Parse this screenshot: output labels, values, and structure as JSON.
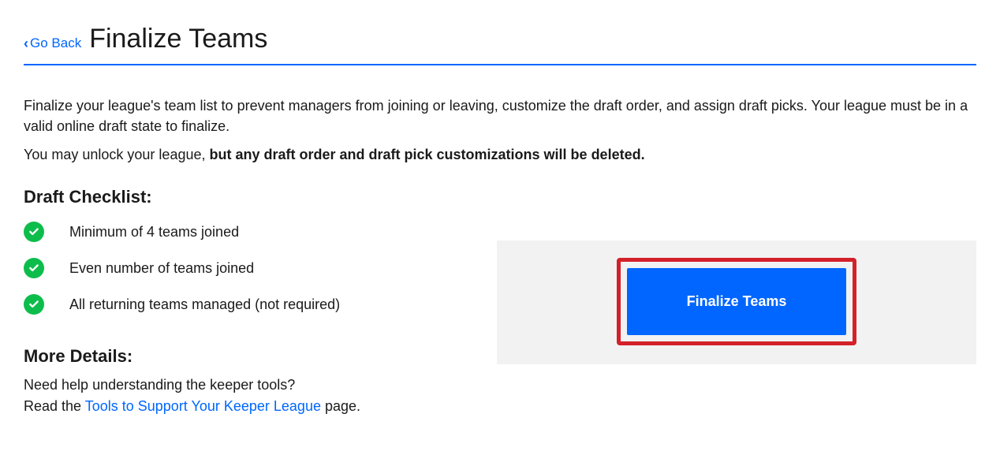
{
  "nav": {
    "go_back_label": "Go Back"
  },
  "page": {
    "title": "Finalize Teams",
    "intro": "Finalize your league's team list to prevent managers from joining or leaving, customize the draft order, and assign draft picks. Your league must be in a valid online draft state to finalize.",
    "unlock_prefix": "You may unlock your league, ",
    "unlock_bold": "but any draft order and draft pick customizations will be deleted."
  },
  "checklist": {
    "heading": "Draft Checklist:",
    "items": [
      {
        "label": "Minimum of 4 teams joined",
        "checked": true
      },
      {
        "label": "Even number of teams joined",
        "checked": true
      },
      {
        "label": "All returning teams managed (not required)",
        "checked": true
      }
    ]
  },
  "more_details": {
    "heading": "More Details:",
    "line1": "Need help understanding the keeper tools?",
    "line2_prefix": "Read the ",
    "link_text": "Tools to Support Your Keeper League",
    "line2_suffix": " page."
  },
  "action": {
    "finalize_label": "Finalize Teams"
  },
  "icons": {
    "chevron_left": "chevron-left-icon",
    "check": "check-icon"
  },
  "colors": {
    "primary_blue": "#0066ff",
    "check_green": "#0dbd4b",
    "highlight_red": "#d32029",
    "panel_bg": "#f2f2f2"
  }
}
